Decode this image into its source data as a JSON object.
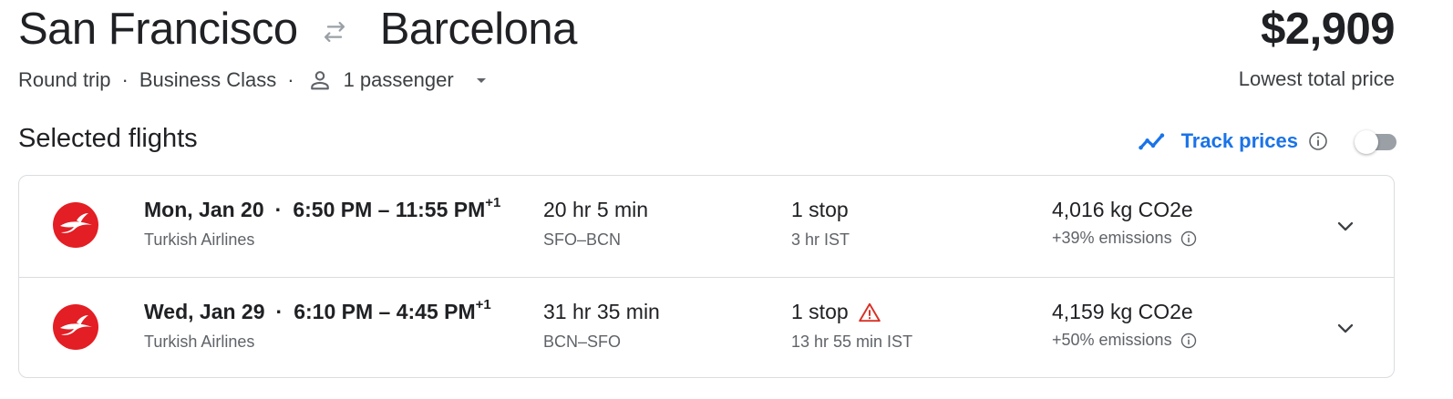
{
  "route": {
    "origin": "San Francisco",
    "destination": "Barcelona",
    "swap_icon": "swap-arrows-icon"
  },
  "price": {
    "amount": "$2,909",
    "label": "Lowest total price"
  },
  "trip": {
    "type": "Round trip",
    "separator": "·",
    "cabin": "Business Class",
    "passengers": "1 passenger"
  },
  "section_title": "Selected flights",
  "track_prices": {
    "label": "Track prices",
    "enabled": false,
    "accent": "#1a73e8"
  },
  "flights": [
    {
      "date": "Mon, Jan 20",
      "separator": "·",
      "time": "6:50 PM – 11:55 PM",
      "day_offset": "+1",
      "airline": "Turkish Airlines",
      "duration": "20 hr 5 min",
      "route": "SFO–BCN",
      "stops": "1 stop",
      "layover": "3 hr IST",
      "warning": false,
      "emissions": "4,016 kg CO2e",
      "emissions_delta": "+39% emissions"
    },
    {
      "date": "Wed, Jan 29",
      "separator": "·",
      "time": "6:10 PM – 4:45 PM",
      "day_offset": "+1",
      "airline": "Turkish Airlines",
      "duration": "31 hr 35 min",
      "route": "BCN–SFO",
      "stops": "1 stop",
      "layover": "13 hr 55 min IST",
      "warning": true,
      "emissions": "4,159 kg CO2e",
      "emissions_delta": "+50% emissions"
    }
  ],
  "colors": {
    "airline_red": "#e31e24",
    "warning_red": "#d93025",
    "text_primary": "#202124",
    "text_secondary": "#5f6368"
  }
}
